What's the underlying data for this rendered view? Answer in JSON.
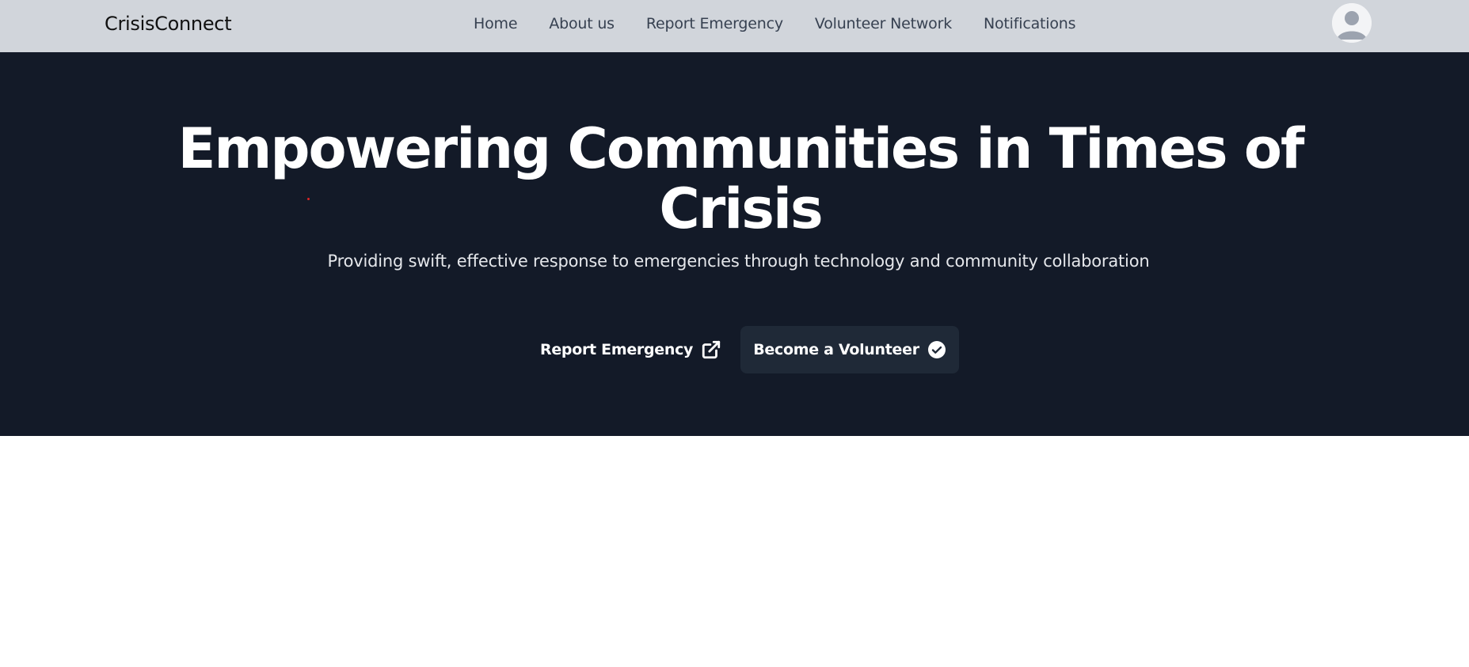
{
  "navbar": {
    "brand": "CrisisConnect",
    "links": [
      {
        "label": "Home"
      },
      {
        "label": "About us"
      },
      {
        "label": "Report Emergency"
      },
      {
        "label": "Volunteer Network"
      },
      {
        "label": "Notifications"
      }
    ],
    "avatar_icon": "user-avatar-icon"
  },
  "hero": {
    "title": "Empowering Communities in Times of Crisis",
    "subtitle": "Providing swift, effective response to emergencies through technology and community collaboration",
    "report_button": {
      "label": "Report Emergency",
      "icon": "external-link-icon"
    },
    "volunteer_button": {
      "label": "Become a Volunteer",
      "icon": "check-circle-icon"
    }
  },
  "colors": {
    "navbar_bg": "#d1d5db",
    "hero_bg": "#131a28",
    "volunteer_button_bg": "#1f2937",
    "text_light": "#ffffff",
    "nav_text": "#374151"
  }
}
